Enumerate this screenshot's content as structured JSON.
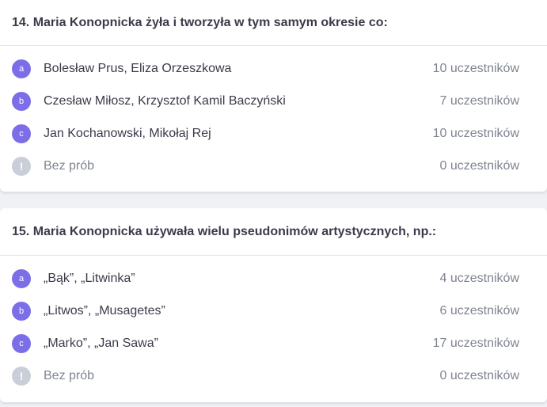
{
  "questions": [
    {
      "title": "14. Maria Konopnicka żyła i tworzyła w tym samym okresie co:",
      "answers": [
        {
          "letter": "a",
          "text": "Bolesław Prus, Eliza Orzeszkowa",
          "count": "10 uczestników"
        },
        {
          "letter": "b",
          "text": "Czesław Miłosz, Krzysztof Kamil Baczyński",
          "count": "7 uczestników"
        },
        {
          "letter": "c",
          "text": "Jan Kochanowski, Mikołaj Rej",
          "count": "10 uczestników"
        }
      ],
      "no_attempt": {
        "icon": "!",
        "text": "Bez prób",
        "count": "0 uczestników"
      }
    },
    {
      "title": "15. Maria Konopnicka używała wielu pseudonimów artystycznych, np.:",
      "answers": [
        {
          "letter": "a",
          "text": "„Bąk”, „Litwinka”",
          "count": "4 uczestników"
        },
        {
          "letter": "b",
          "text": "„Litwos”, „Musagetes”",
          "count": "6 uczestników"
        },
        {
          "letter": "c",
          "text": "„Marko”, „Jan Sawa”",
          "count": "17 uczestników"
        }
      ],
      "no_attempt": {
        "icon": "!",
        "text": "Bez prób",
        "count": "0 uczestników"
      }
    }
  ],
  "colors": {
    "badge": "#7b6ee8",
    "badge_none": "#c9ced8",
    "muted_text": "#7f8491"
  }
}
